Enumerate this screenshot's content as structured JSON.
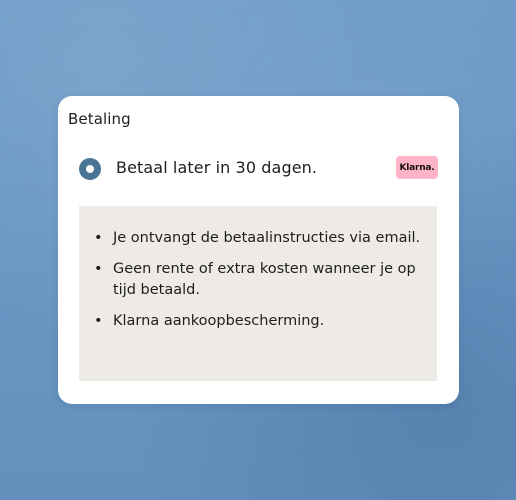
{
  "card": {
    "title": "Betaling"
  },
  "payment_option": {
    "label": "Betaal later in 30 dagen.",
    "selected": true,
    "badge": "Klarna.",
    "badge_color": "#ffb3c7"
  },
  "info": {
    "bullets": [
      "Je ontvangt de betaalinstructies via email.",
      "Geen rente of extra kosten wanneer je op tijd betaald.",
      "Klarna aankoopbescherming."
    ]
  },
  "colors": {
    "radio": "#4a7494",
    "info_bg": "#eeebe7",
    "background": "#6896c3"
  }
}
